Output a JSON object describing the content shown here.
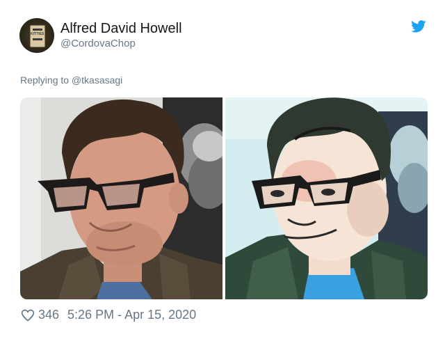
{
  "tweet": {
    "author": {
      "display_name": "Alfred David Howell",
      "handle": "@CordovaChop",
      "avatar_text": "KITTIES"
    },
    "replying_to": "Replying to @tkasasagi",
    "media": [
      {
        "name": "original-photo"
      },
      {
        "name": "cartoon-filtered-photo"
      }
    ],
    "likes": "346",
    "timestamp": "5:26 PM - Apr 15, 2020",
    "colors": {
      "twitter_blue": "#1da1f2",
      "secondary_text": "#657786",
      "primary_text": "#14171a"
    },
    "icons": [
      "twitter-bird-icon",
      "heart-outline-icon"
    ]
  }
}
